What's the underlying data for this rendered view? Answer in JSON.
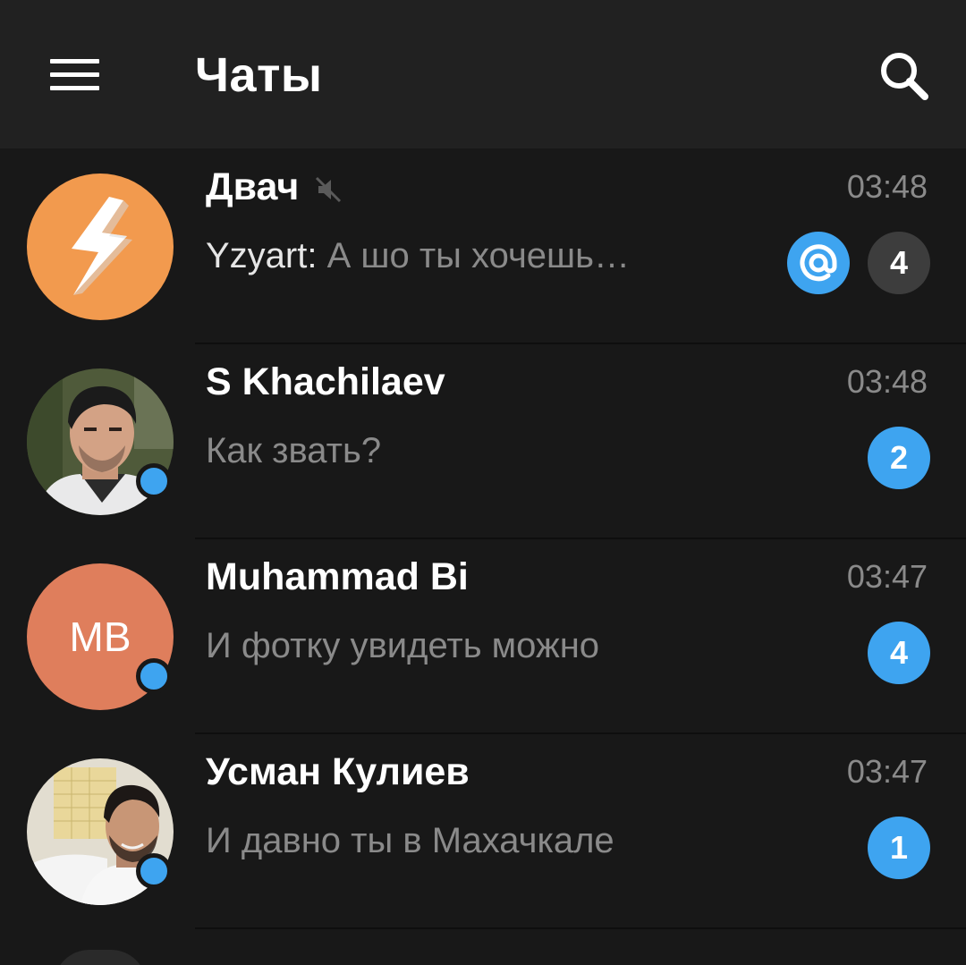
{
  "header": {
    "title": "Чаты",
    "menu_icon": "hamburger-menu-icon",
    "search_icon": "search-icon"
  },
  "colors": {
    "background": "#181818",
    "header": "#212121",
    "accent": "#3ea4f0",
    "muted_badge": "#3d3d3d"
  },
  "chats": [
    {
      "name": "Двач",
      "muted": true,
      "time": "03:48",
      "sender": "Yzyart:",
      "preview": " А шо ты хочешь…",
      "mention": true,
      "unread": "4",
      "badge_style": "muted",
      "avatar_icon": "lightning-bolt-icon",
      "avatar_color": "#f29a4e"
    },
    {
      "name": "S Khachilaev",
      "time": "03:48",
      "preview": "Как звать?",
      "unread": "2",
      "online": true,
      "avatar_icon": "profile-photo"
    },
    {
      "name": "Muhammad Bi",
      "time": "03:47",
      "preview": "И фотку увидеть можно",
      "unread": "4",
      "online": true,
      "initials": "MB",
      "avatar_color": "#df7e5c"
    },
    {
      "name": "Усман Кулиев",
      "time": "03:47",
      "preview": "И давно ты в Махачкале",
      "unread": "1",
      "online": true,
      "avatar_icon": "profile-photo"
    }
  ]
}
